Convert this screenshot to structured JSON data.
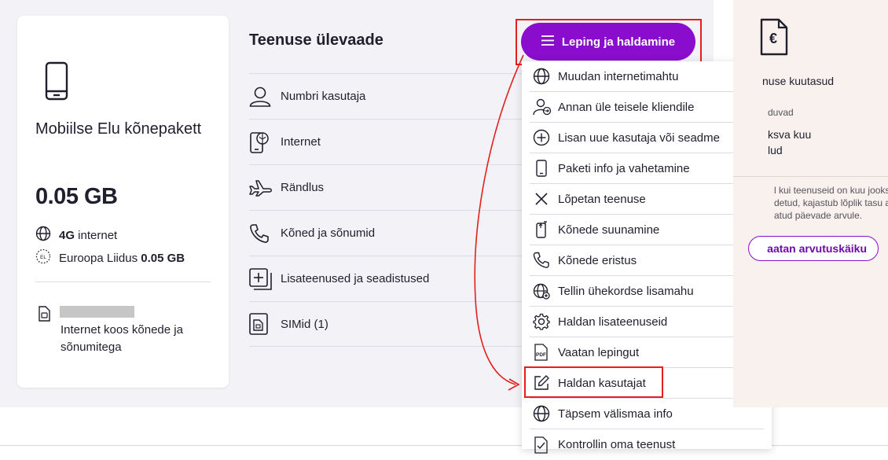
{
  "package": {
    "name": "Mobiilse Elu kõnepakett",
    "data_amount": "0.05 GB",
    "feature_1_bold": "4G",
    "feature_1_text": " internet",
    "feature_2_text": "Euroopa Liidus ",
    "feature_2_bold": "0.05 GB",
    "sim_description": "Internet koos kõnede ja sõnumitega",
    "icons": [
      "phone-icon",
      "globe-icon",
      "eu-icon",
      "sim-icon"
    ]
  },
  "service_overview": {
    "title": "Teenuse ülevaade",
    "items": [
      {
        "label": "Numbri kasutaja",
        "icon": "user-icon"
      },
      {
        "label": "Internet",
        "icon": "phone-data-icon"
      },
      {
        "label": "Rändlus",
        "icon": "plane-icon"
      },
      {
        "label": "Kõned ja sõnumid",
        "icon": "phone-call-icon"
      },
      {
        "label": "Lisateenused ja seadistused",
        "icon": "plus-square-icon"
      },
      {
        "label": "SIMid (1)",
        "icon": "sim-icon"
      }
    ]
  },
  "manage_button": {
    "label": "Leping ja haldamine",
    "icon": "menu-icon"
  },
  "dropdown": {
    "items": [
      {
        "label": "Muudan internetimahtu",
        "icon": "globe-icon"
      },
      {
        "label": "Annan üle teisele kliendile",
        "icon": "user-transfer-icon"
      },
      {
        "label": "Lisan uue kasutaja või seadme",
        "icon": "plus-circle-icon"
      },
      {
        "label": "Paketi info ja vahetamine",
        "icon": "phone-icon"
      },
      {
        "label": "Lõpetan teenuse",
        "icon": "close-icon"
      },
      {
        "label": "Kõnede suunamine",
        "icon": "call-forward-icon"
      },
      {
        "label": "Kõnede eristus",
        "icon": "phone-call-icon"
      },
      {
        "label": "Tellin ühekordse lisamahu",
        "icon": "globe-plus-icon"
      },
      {
        "label": "Haldan lisateenuseid",
        "icon": "gear-icon"
      },
      {
        "label": "Vaatan lepingut",
        "icon": "pdf-icon"
      },
      {
        "label": "Haldan kasutajat",
        "icon": "edit-icon"
      },
      {
        "label": "Täpsem välismaa info",
        "icon": "globe-icon"
      },
      {
        "label": "Kontrollin oma teenust",
        "icon": "checklist-icon"
      }
    ]
  },
  "right_panel": {
    "line_1": "nuse kuutasud",
    "line_2": "duvad",
    "line_3": "ksva kuu",
    "line_4": "lud",
    "note_1": "l kui teenuseid on kuu jooksu",
    "note_2": "detud, kajastub lõplik tasu ar",
    "note_3": "atud päevade arvule.",
    "button_label": "aatan arvutuskäiku",
    "icon": "euro-document-icon"
  },
  "colors": {
    "accent": "#8a0ccd",
    "highlight": "#e3201f",
    "background": "#f3f2f6"
  }
}
